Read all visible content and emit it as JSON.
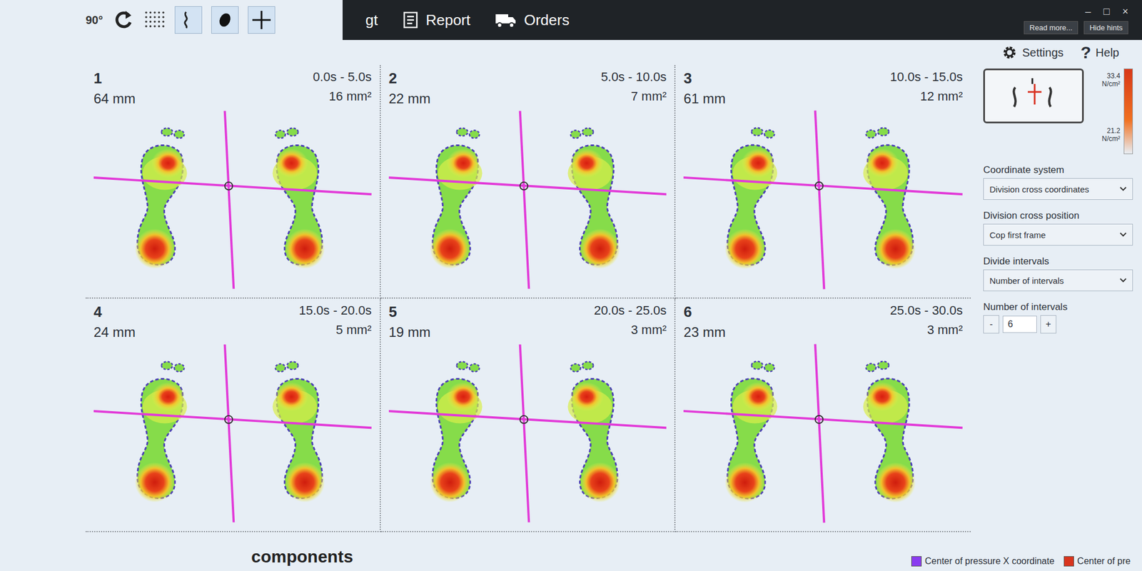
{
  "toolbar": {
    "angle": "90°",
    "tools": [
      {
        "kind": "line",
        "selected": true
      },
      {
        "kind": "dot",
        "selected": true
      },
      {
        "kind": "cross",
        "selected": true
      }
    ]
  },
  "menu": [
    {
      "label": "gt",
      "kind": "text"
    },
    {
      "label": "Report",
      "kind": "report"
    },
    {
      "label": "Orders",
      "kind": "orders"
    }
  ],
  "window_controls": [
    "–",
    "□",
    "×"
  ],
  "hint_buttons": [
    "Read more...",
    "Hide hints"
  ],
  "settings": {
    "label": "Settings"
  },
  "help": {
    "icon": "?",
    "label": "Help"
  },
  "panels": [
    {
      "number": "1",
      "distance": "64 mm",
      "time": "0.0s - 5.0s",
      "area": "16 mm²"
    },
    {
      "number": "2",
      "distance": "22 mm",
      "time": "5.0s - 10.0s",
      "area": "7 mm²"
    },
    {
      "number": "3",
      "distance": "61 mm",
      "time": "10.0s - 15.0s",
      "area": "12 mm²"
    },
    {
      "number": "4",
      "distance": "24 mm",
      "time": "15.0s - 20.0s",
      "area": "5 mm²"
    },
    {
      "number": "5",
      "distance": "19 mm",
      "time": "20.0s - 25.0s",
      "area": "3 mm²"
    },
    {
      "number": "6",
      "distance": "23 mm",
      "time": "25.0s - 30.0s",
      "area": "3 mm²"
    }
  ],
  "scale": {
    "max": "33.4 N/cm²",
    "min": "21.2 N/cm²"
  },
  "controls": [
    {
      "label": "Coordinate system",
      "kind": "dropdown",
      "value": "Division cross coordinates"
    },
    {
      "label": "Division cross position",
      "kind": "dropdown",
      "value": "Cop first frame"
    },
    {
      "label": "Divide intervals",
      "kind": "dropdown",
      "value": "Number of intervals"
    },
    {
      "label": "Number of intervals",
      "kind": "stepper",
      "value": "6",
      "minus": "-",
      "plus": "+"
    }
  ],
  "legend": [
    {
      "label": "Center of pressure X coordinate",
      "color": "#8a3cf0"
    },
    {
      "label": "Center of pre",
      "color": "#d8351e"
    }
  ],
  "chart_title": "components"
}
